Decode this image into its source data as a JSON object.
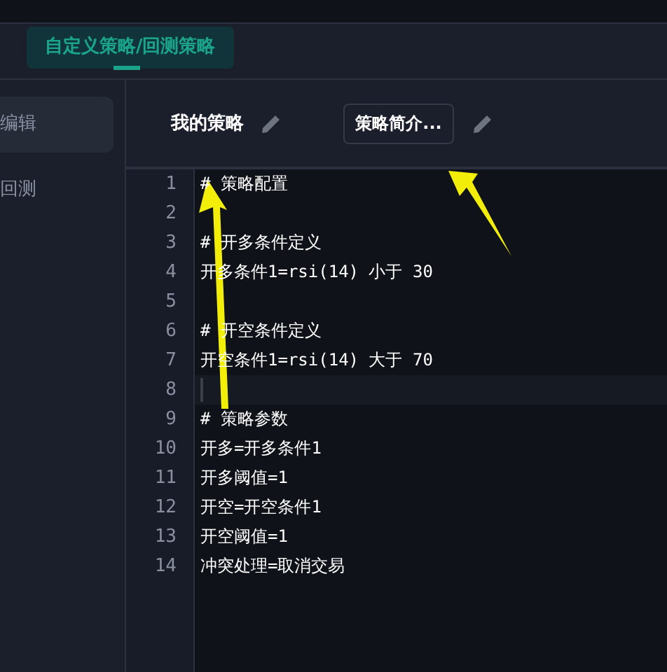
{
  "tabs": [
    {
      "label": "自定义策略/回测策略",
      "selected": true
    }
  ],
  "sidebar": {
    "items": [
      {
        "label": "编辑",
        "selected": true
      },
      {
        "label": "回测",
        "selected": false
      }
    ]
  },
  "header": {
    "strategy_name": "我的策略",
    "description_button": "策略简介..."
  },
  "editor": {
    "lines": [
      {
        "number": "1",
        "text": "# 策略配置",
        "current": false
      },
      {
        "number": "2",
        "current": false
      },
      {
        "number": "3",
        "text": "# 开多条件定义",
        "current": false
      },
      {
        "number": "4",
        "text": "开多条件1=rsi(14) 小于 30",
        "current": false
      },
      {
        "number": "5",
        "current": false
      },
      {
        "number": "6",
        "text": "# 开空条件定义",
        "current": false
      },
      {
        "number": "7",
        "text": "开空条件1=rsi(14) 大于 70",
        "current": false
      },
      {
        "number": "8",
        "current": true
      },
      {
        "number": "9",
        "text": "# 策略参数",
        "current": false
      },
      {
        "number": "10",
        "text": "开多=开多条件1",
        "current": false
      },
      {
        "number": "11",
        "text": "开多阈值=1",
        "current": false
      },
      {
        "number": "12",
        "text": "开空=开空条件1",
        "current": false
      },
      {
        "number": "13",
        "text": "开空阈值=1",
        "current": false
      },
      {
        "number": "14",
        "text": "冲突处理=取消交易",
        "current": false
      }
    ]
  }
}
